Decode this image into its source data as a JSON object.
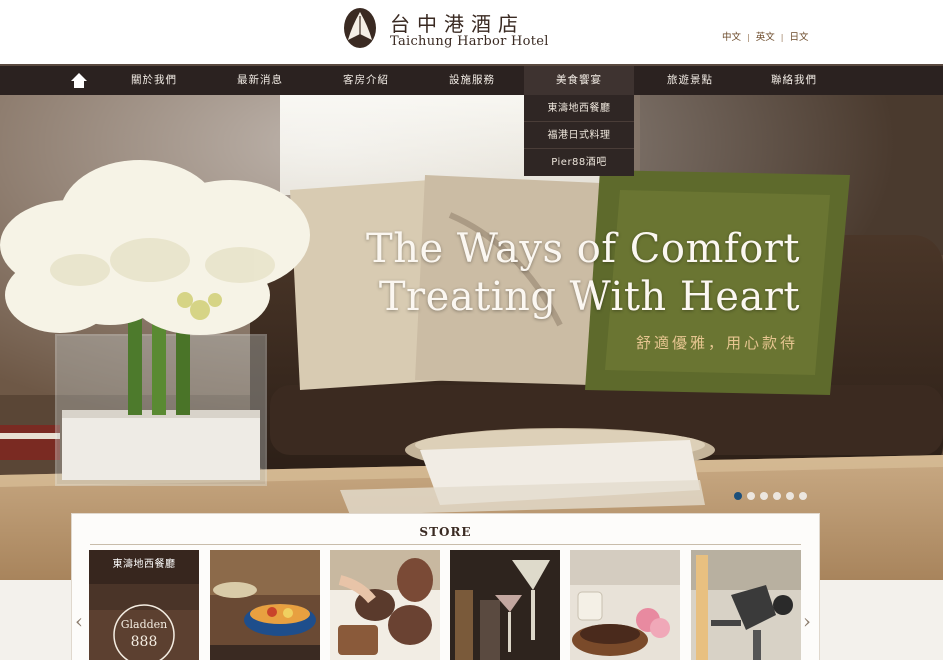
{
  "header": {
    "logo_cn": "台中港酒店",
    "logo_en": "Taichung Harbor Hotel",
    "languages": [
      "中文",
      "英文",
      "日文"
    ]
  },
  "nav": {
    "home_icon": "home-icon",
    "items": [
      {
        "label": "關於我們"
      },
      {
        "label": "最新消息"
      },
      {
        "label": "客房介紹"
      },
      {
        "label": "設施服務"
      },
      {
        "label": "美食饗宴",
        "active": true
      },
      {
        "label": "旅遊景點"
      },
      {
        "label": "聯絡我們"
      }
    ],
    "dropdown": [
      "東濤地西餐廳",
      "福港日式料理",
      "Pier88酒吧"
    ]
  },
  "hero": {
    "title_line1": "The Ways of  Comfort",
    "title_line2": "Treating With Heart",
    "subtitle": "舒適優雅，用心款待",
    "slide_count": 6,
    "active_slide": 1
  },
  "store": {
    "title": "STORE",
    "prev_icon": "chevron-left-icon",
    "next_icon": "chevron-right-icon",
    "prev_glyph": "‹",
    "next_glyph": "›",
    "items": [
      {
        "label": "東濤地西餐廳",
        "logo_text": "Gladden",
        "logo_number": "888"
      },
      {
        "label": ""
      },
      {
        "label": ""
      },
      {
        "label": ""
      },
      {
        "label": ""
      },
      {
        "label": ""
      }
    ]
  },
  "colors": {
    "nav_bg": "#2b2220",
    "accent_gold": "#e6c590",
    "active_dot": "#1c4f7a"
  }
}
